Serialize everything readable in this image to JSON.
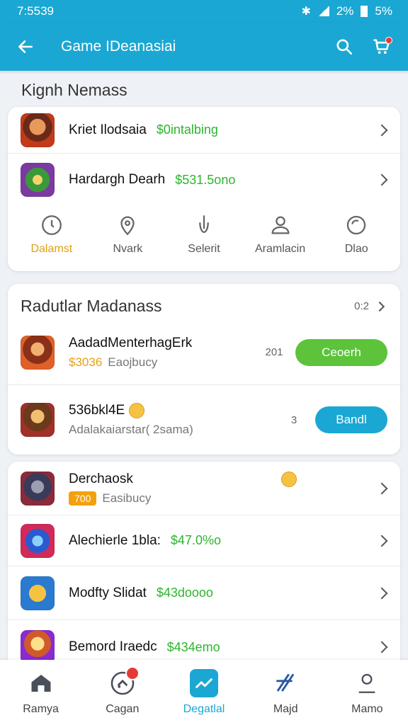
{
  "status": {
    "time": "7:5539",
    "battery_pct": "2%",
    "signal": "5%"
  },
  "appbar": {
    "title": "Game IDeanasiai"
  },
  "section1": {
    "title": "Kignh Nemass"
  },
  "card1": {
    "rows": [
      {
        "name": "Kriet Ilodsaia",
        "price": "$0intalbing"
      },
      {
        "name": "Hardargh Dearh",
        "price": "$531.5ono"
      }
    ],
    "quick": [
      {
        "label": "Dalamst",
        "icon": "clock-icon",
        "active": true
      },
      {
        "label": "Nvark",
        "icon": "pin-icon"
      },
      {
        "label": "Selerit",
        "icon": "hand-icon"
      },
      {
        "label": "Aramlacin",
        "icon": "person-icon"
      },
      {
        "label": "Dlao",
        "icon": "chat-bubble-icon"
      }
    ]
  },
  "card2": {
    "title": "Radutlar Madanass",
    "count": "0:2",
    "rows": [
      {
        "title": "AadadMenterhagErk",
        "amount": "$3036",
        "sub": "Eaojbucy",
        "num": "201",
        "button": "Ceoerh"
      },
      {
        "title": "536bkl4E",
        "amount": "",
        "sub": "Adalakaiarstar( 2sama)",
        "num": "3",
        "button": "Bandl"
      }
    ]
  },
  "card3": {
    "rows": [
      {
        "name": "Derchaosk",
        "chip": "700",
        "sub": "Easibucy"
      },
      {
        "name": "Alechierle 1bla:",
        "price": "$47.0%o"
      },
      {
        "name": "Modfty Slidat",
        "price": "$43doooo"
      },
      {
        "name": "Bemord Iraedc",
        "price": "$434emo"
      }
    ]
  },
  "nav": [
    {
      "label": "Ramya",
      "icon": "home-icon"
    },
    {
      "label": "Cagan",
      "icon": "gamepad-icon"
    },
    {
      "label": "Degatlal",
      "icon": "chart-icon",
      "active": true
    },
    {
      "label": "Majd",
      "icon": "brand-icon"
    },
    {
      "label": "Mamo",
      "icon": "profile-icon"
    }
  ],
  "colors": {
    "primary": "#1aa7d3",
    "green": "#5cc33a",
    "price_green": "#2db52d",
    "orange": "#f3a10c"
  }
}
